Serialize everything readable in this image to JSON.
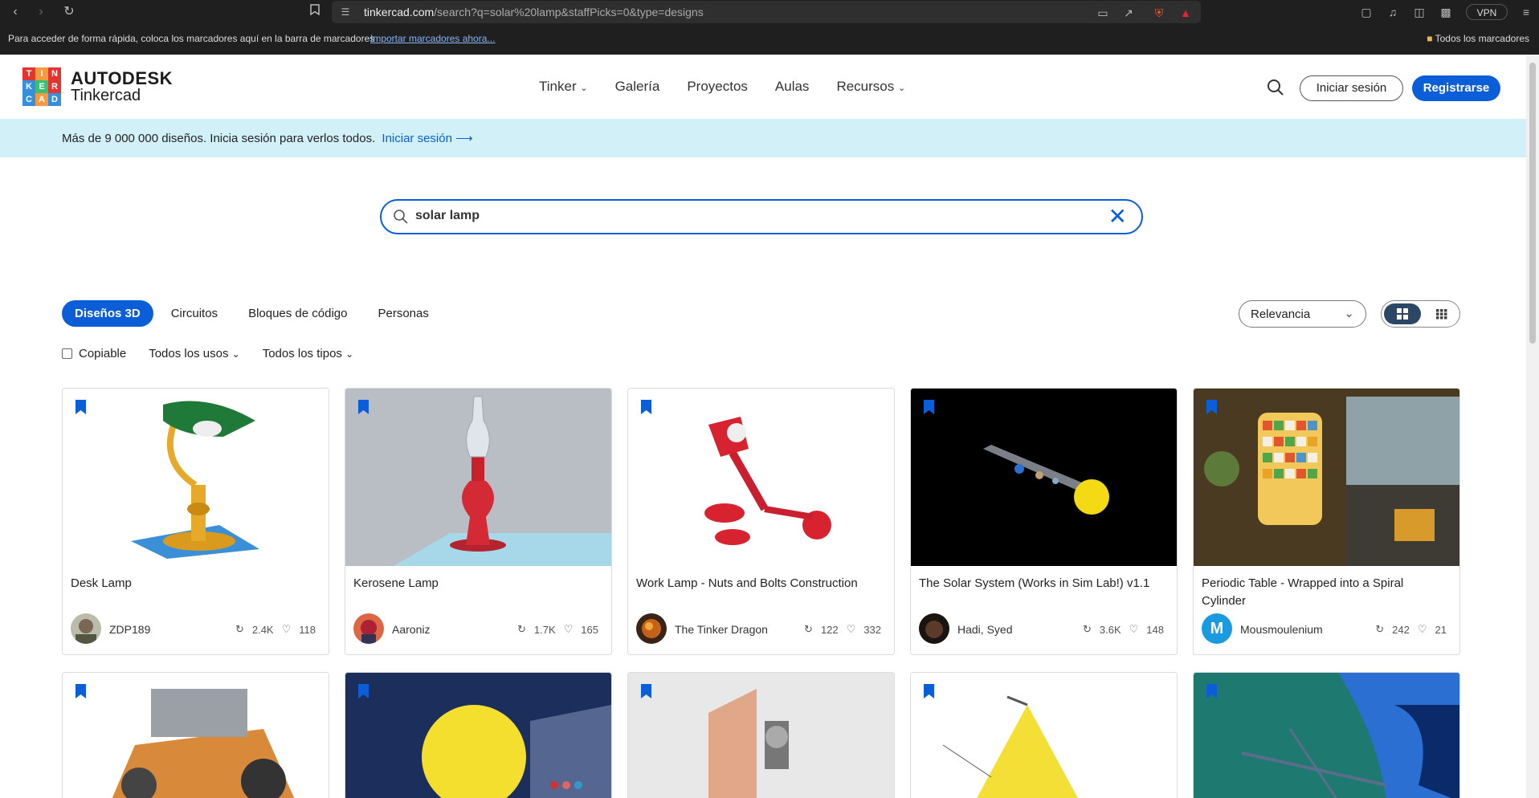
{
  "browser": {
    "url_domain": "tinkercad.com",
    "url_path": "/search?q=solar%20lamp&staffPicks=0&type=designs",
    "bookmarks_hint": "Para acceder de forma rápida, coloca los marcadores aquí en la barra de marcadores",
    "bookmarks_import": "Importar marcadores ahora...",
    "bookmarks_all": "Todos los marcadores",
    "vpn": "VPN"
  },
  "header": {
    "logo_letters": [
      "T",
      "I",
      "N",
      "K",
      "E",
      "R",
      "C",
      "A",
      "D"
    ],
    "brand_top": "AUTODESK",
    "brand_bottom": "Tinkercad",
    "nav": [
      "Tinker",
      "Galería",
      "Proyectos",
      "Aulas",
      "Recursos"
    ],
    "login": "Iniciar sesión",
    "register": "Registrarse"
  },
  "banner": {
    "text": "Más de 9 000 000 diseños. Inicia sesión para verlos todos.",
    "link": "Iniciar sesión"
  },
  "search": {
    "value": "solar lamp"
  },
  "tabs": [
    "Diseños 3D",
    "Circuitos",
    "Bloques de código",
    "Personas"
  ],
  "sort": {
    "value": "Relevancia"
  },
  "filters": {
    "copyable": "Copiable",
    "uses": "Todos los usos",
    "types": "Todos los tipos"
  },
  "cards": [
    {
      "title": "Desk Lamp",
      "author": "ZDP189",
      "remixes": "2.4K",
      "likes": "118"
    },
    {
      "title": "Kerosene Lamp",
      "author": "Aaroniz",
      "remixes": "1.7K",
      "likes": "165"
    },
    {
      "title": "Work Lamp - Nuts and Bolts Construction",
      "author": "The Tinker Dragon",
      "remixes": "122",
      "likes": "332"
    },
    {
      "title": "The Solar System (Works in Sim Lab!) v1.1",
      "author": "Hadi, Syed",
      "remixes": "3.6K",
      "likes": "148"
    },
    {
      "title": "Periodic Table - Wrapped into a Spiral Cylinder",
      "author": "Mousmoulenium",
      "remixes": "242",
      "likes": "21"
    }
  ],
  "avatar_letter_m": "M"
}
